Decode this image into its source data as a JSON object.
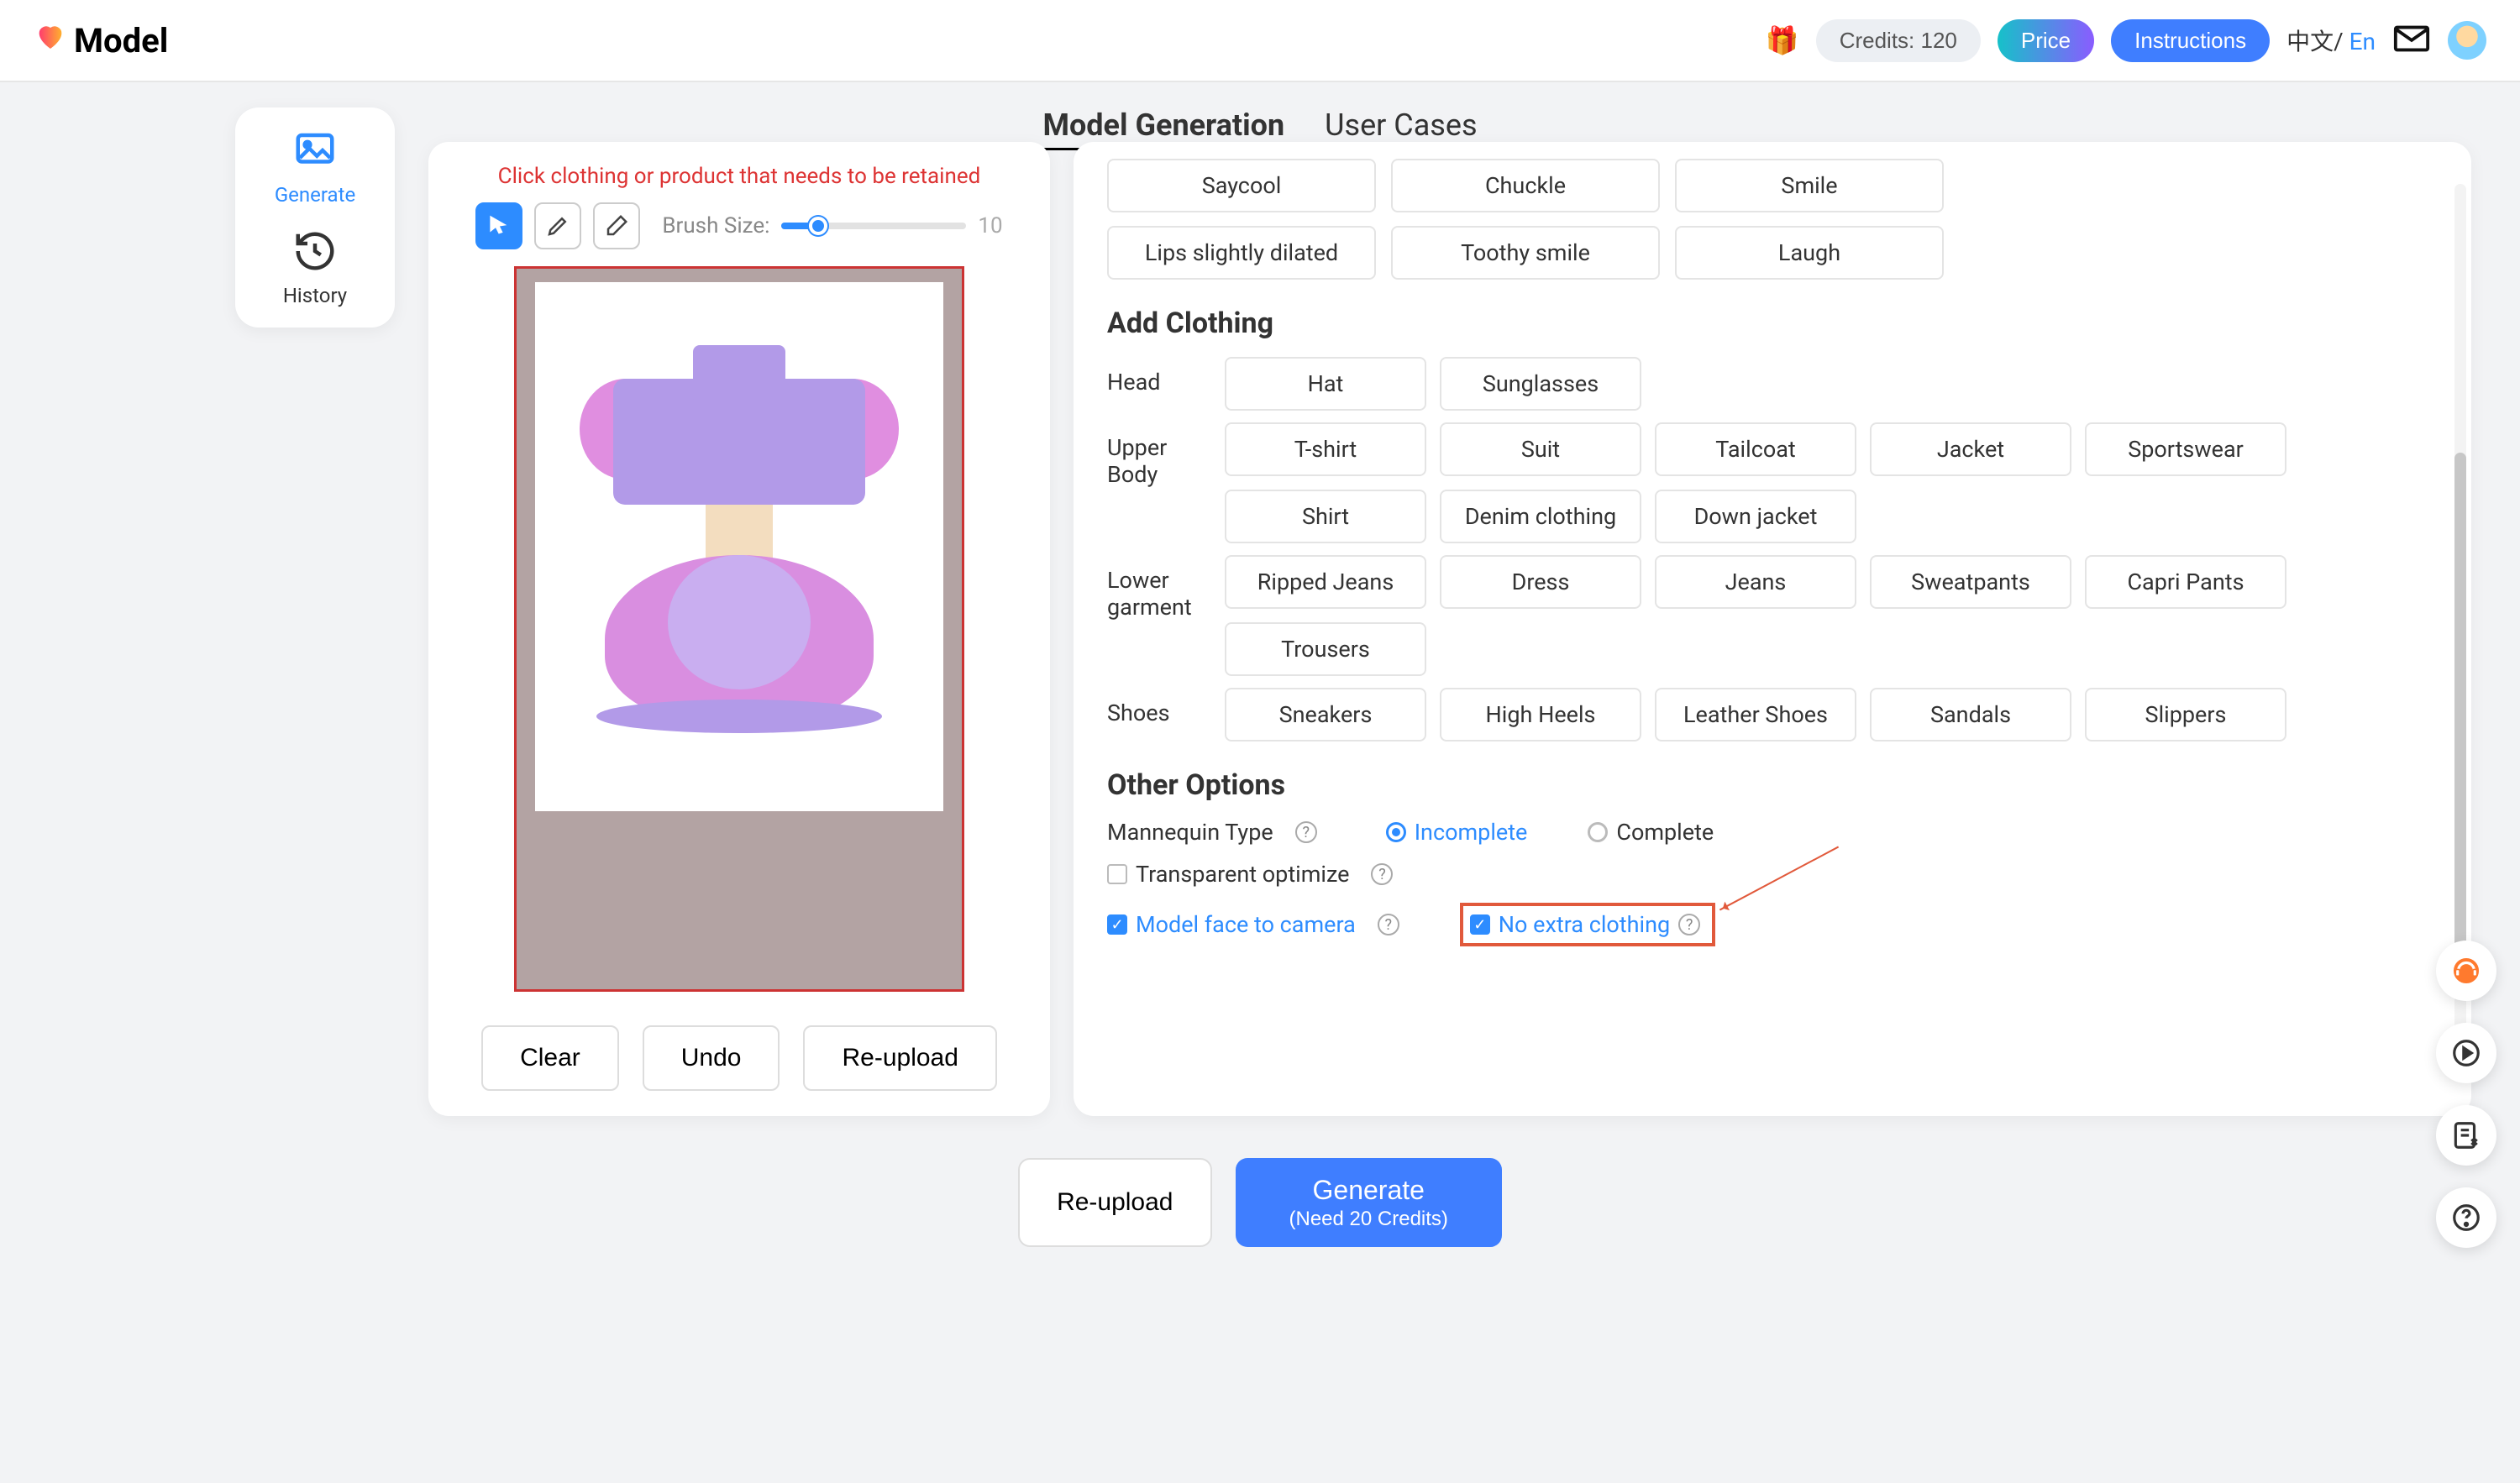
{
  "header": {
    "brand": "Model",
    "credits": "Credits: 120",
    "price": "Price",
    "instructions": "Instructions",
    "lang_zh": "中文/",
    "lang_en": "En"
  },
  "tabs": {
    "model_gen": "Model Generation",
    "user_cases": "User Cases"
  },
  "rail": {
    "generate": "Generate",
    "history": "History"
  },
  "canvas": {
    "hint": "Click clothing or product that needs to be retained",
    "brush_label": "Brush Size:",
    "brush_value": "10",
    "clear": "Clear",
    "undo": "Undo",
    "reupload": "Re-upload"
  },
  "expression_opts": [
    "Saycool",
    "Chuckle",
    "Smile",
    "Lips slightly dilated",
    "Toothy smile",
    "Laugh"
  ],
  "add_clothing_title": "Add Clothing",
  "clothing": {
    "head_label": "Head",
    "head": [
      "Hat",
      "Sunglasses"
    ],
    "upper_label": "Upper Body",
    "upper": [
      "T-shirt",
      "Suit",
      "Tailcoat",
      "Jacket",
      "Sportswear",
      "Shirt",
      "Denim clothing",
      "Down jacket"
    ],
    "lower_label": "Lower garment",
    "lower": [
      "Ripped Jeans",
      "Dress",
      "Jeans",
      "Sweatpants",
      "Capri Pants",
      "Trousers"
    ],
    "shoes_label": "Shoes",
    "shoes": [
      "Sneakers",
      "High Heels",
      "Leather Shoes",
      "Sandals",
      "Slippers"
    ]
  },
  "other": {
    "title": "Other Options",
    "mannequin_label": "Mannequin Type",
    "incomplete": "Incomplete",
    "complete": "Complete",
    "transparent": "Transparent optimize",
    "face_cam": "Model face to camera",
    "no_extra": "No extra clothing"
  },
  "bottom": {
    "reupload": "Re-upload",
    "generate": "Generate",
    "need": "(Need 20 Credits)"
  }
}
